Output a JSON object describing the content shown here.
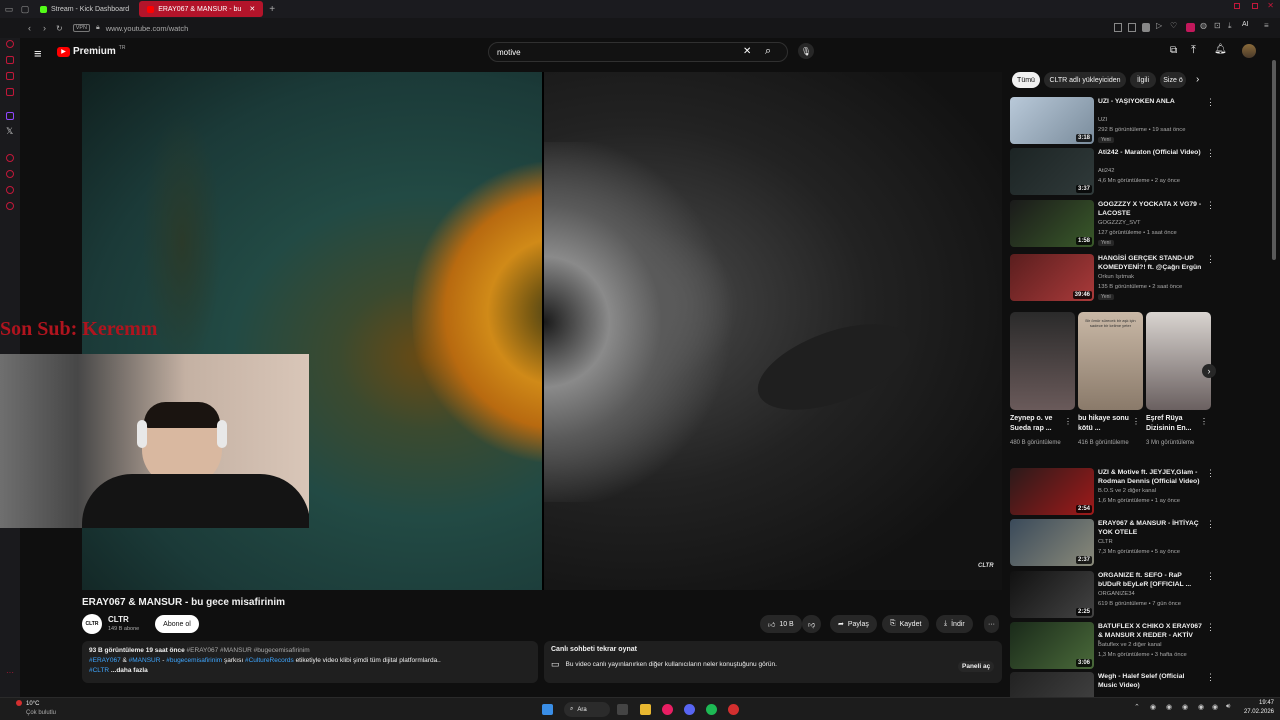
{
  "browser": {
    "tabs": [
      {
        "label": "Stream - Kick Dashboard",
        "active": false
      },
      {
        "label": "ERAY067 & MANSUR - bu",
        "active": true
      }
    ],
    "vpn_label": "VPN",
    "url": "www.youtube.com/watch",
    "ai_label": "AI"
  },
  "youtube": {
    "logo_text": "Premium",
    "logo_region": "TR",
    "search_value": "motive",
    "video": {
      "title": "ERAY067 & MANSUR - bu gece misafirinim",
      "watermark": "CLTR",
      "channel_name": "CLTR",
      "channel_avatar_text": "CLTR",
      "subscribers": "149 B abone",
      "subscribe_label": "Abone ol",
      "likes": "10 B",
      "share_label": "Paylaş",
      "save_label": "Kaydet",
      "download_label": "İndir"
    },
    "overlay": {
      "cam_text": "Son Sub: Keremm"
    },
    "description": {
      "stats": "93 B görüntüleme  19 saat önce",
      "tags_inline": "#ERAY067 #MANSUR #bugecemisafirinim",
      "line2_a": "#ERAY067",
      "line2_amp": " & ",
      "line2_b": "#MANSUR",
      "line2_dash": " - ",
      "line2_c": "#bugecemisafirinim",
      "line2_text1": " şarkısı ",
      "line2_d": "#CultureRecords",
      "line2_text2": " etiketiyle video klibi şimdi tüm dijital platformlarda..",
      "line3_tag": "#CLTR",
      "more": " ...daha fazla"
    },
    "chat": {
      "title": "Canlı sohbeti tekrar oynat",
      "text": "Bu video canlı yayınlanırken diğer kullanıcıların neler konuştuğunu görün.",
      "open_label": "Paneli aç"
    },
    "filter_chips": [
      "Tümü",
      "CLTR adlı yükleyiciden",
      "İlgili",
      "Size ö"
    ],
    "recommendations": [
      {
        "title": "UZI - YAŞIYOKEN ANLA",
        "channel": "UZI",
        "stats": "292 B görüntüleme • 19 saat önce",
        "badge": "Yeni",
        "duration": "3:18",
        "colors": [
          "#b9c9d9",
          "#7a8c9c"
        ]
      },
      {
        "title": "Ati242 - Maraton (Official Video)",
        "channel": "Ati242",
        "stats": "4,6 Mn görüntüleme • 2 ay önce",
        "badge": "",
        "duration": "3:37",
        "colors": [
          "#1c2424",
          "#303a3a"
        ]
      },
      {
        "title": "GOGZZZY X YOCKATA X VG79 - LACOSTE",
        "channel": "GOGZZZY_SVT",
        "stats": "127 görüntüleme • 1 saat önce",
        "badge": "Yeni",
        "duration": "1:58",
        "colors": [
          "#1a1a1a",
          "#3a5a2a"
        ]
      },
      {
        "title": "HANGİSİ GERÇEK STAND-UP KOMEDYENİ?! ft. @Çağrı Ergün",
        "channel": "Orkun Işıtmak",
        "stats": "135 B görüntüleme • 2 saat önce",
        "badge": "Yeni",
        "duration": "39:46",
        "colors": [
          "#5a1e1e",
          "#aa3a3a"
        ]
      },
      {
        "title": "UZI & Motive ft. JEYJEY,Glam - Rodman Dennis (Official Video)",
        "channel": "B.O.S ve 2 diğer kanal",
        "stats": "1,6 Mn görüntüleme • 1 ay önce",
        "badge": "",
        "duration": "2:54",
        "colors": [
          "#2a1a1a",
          "#a01a1a"
        ]
      },
      {
        "title": "ERAY067 & MANSUR - İHTİYAÇ YOK OTELE",
        "channel": "CLTR",
        "stats": "7,3 Mn görüntüleme • 5 ay önce",
        "badge": "",
        "duration": "2:37",
        "colors": [
          "#3a4a5a",
          "#8a8a7a"
        ]
      },
      {
        "title": "ORGANIZE ft. SEFO - RaP bUDuR bEyLeR [OFFICIAL ...",
        "channel": "ORGANIZE34",
        "stats": "619 B görüntüleme • 7 gün önce",
        "badge": "",
        "duration": "2:25",
        "colors": [
          "#111",
          "#444"
        ]
      },
      {
        "title": "BATUFLEX X CHIKO X ERAY067 & MANSUR X REDER - AKTİV İ...",
        "channel": "Batuflex ve 2 diğer kanal",
        "stats": "1,3 Mn görüntüleme • 3 hafta önce",
        "badge": "",
        "duration": "3:06",
        "colors": [
          "#1a2a1a",
          "#4a6a3a"
        ]
      },
      {
        "title": "Wegh - Halef Selef (Official Music Video)",
        "channel": "",
        "stats": "",
        "badge": "",
        "duration": "",
        "colors": [
          "#222",
          "#444"
        ]
      }
    ],
    "shorts": [
      {
        "title": "Zeynep o. ve Sueda rap ...",
        "views": "480 B görüntüleme",
        "colors": [
          "#2a2a2a",
          "#6a5a5a"
        ]
      },
      {
        "title": "bu hikaye sonu kötü ...",
        "views": "416 B görüntüleme",
        "colors": [
          "#c9b8a6",
          "#8a7a6a"
        ]
      },
      {
        "title": "Eşref Rüya Dizisinin En...",
        "views": "3 Mn görüntüleme",
        "colors": [
          "#d9d4d0",
          "#6a6060"
        ]
      }
    ],
    "short_overlay_text": "Bir ömür sürecek bir aşk için sadece bir kelime yeter"
  },
  "taskbar": {
    "weather_temp": "10°C",
    "weather_desc": "Çok bulutlu",
    "search_label": "Ara",
    "time": "19:47",
    "date": "27.02.2026"
  }
}
